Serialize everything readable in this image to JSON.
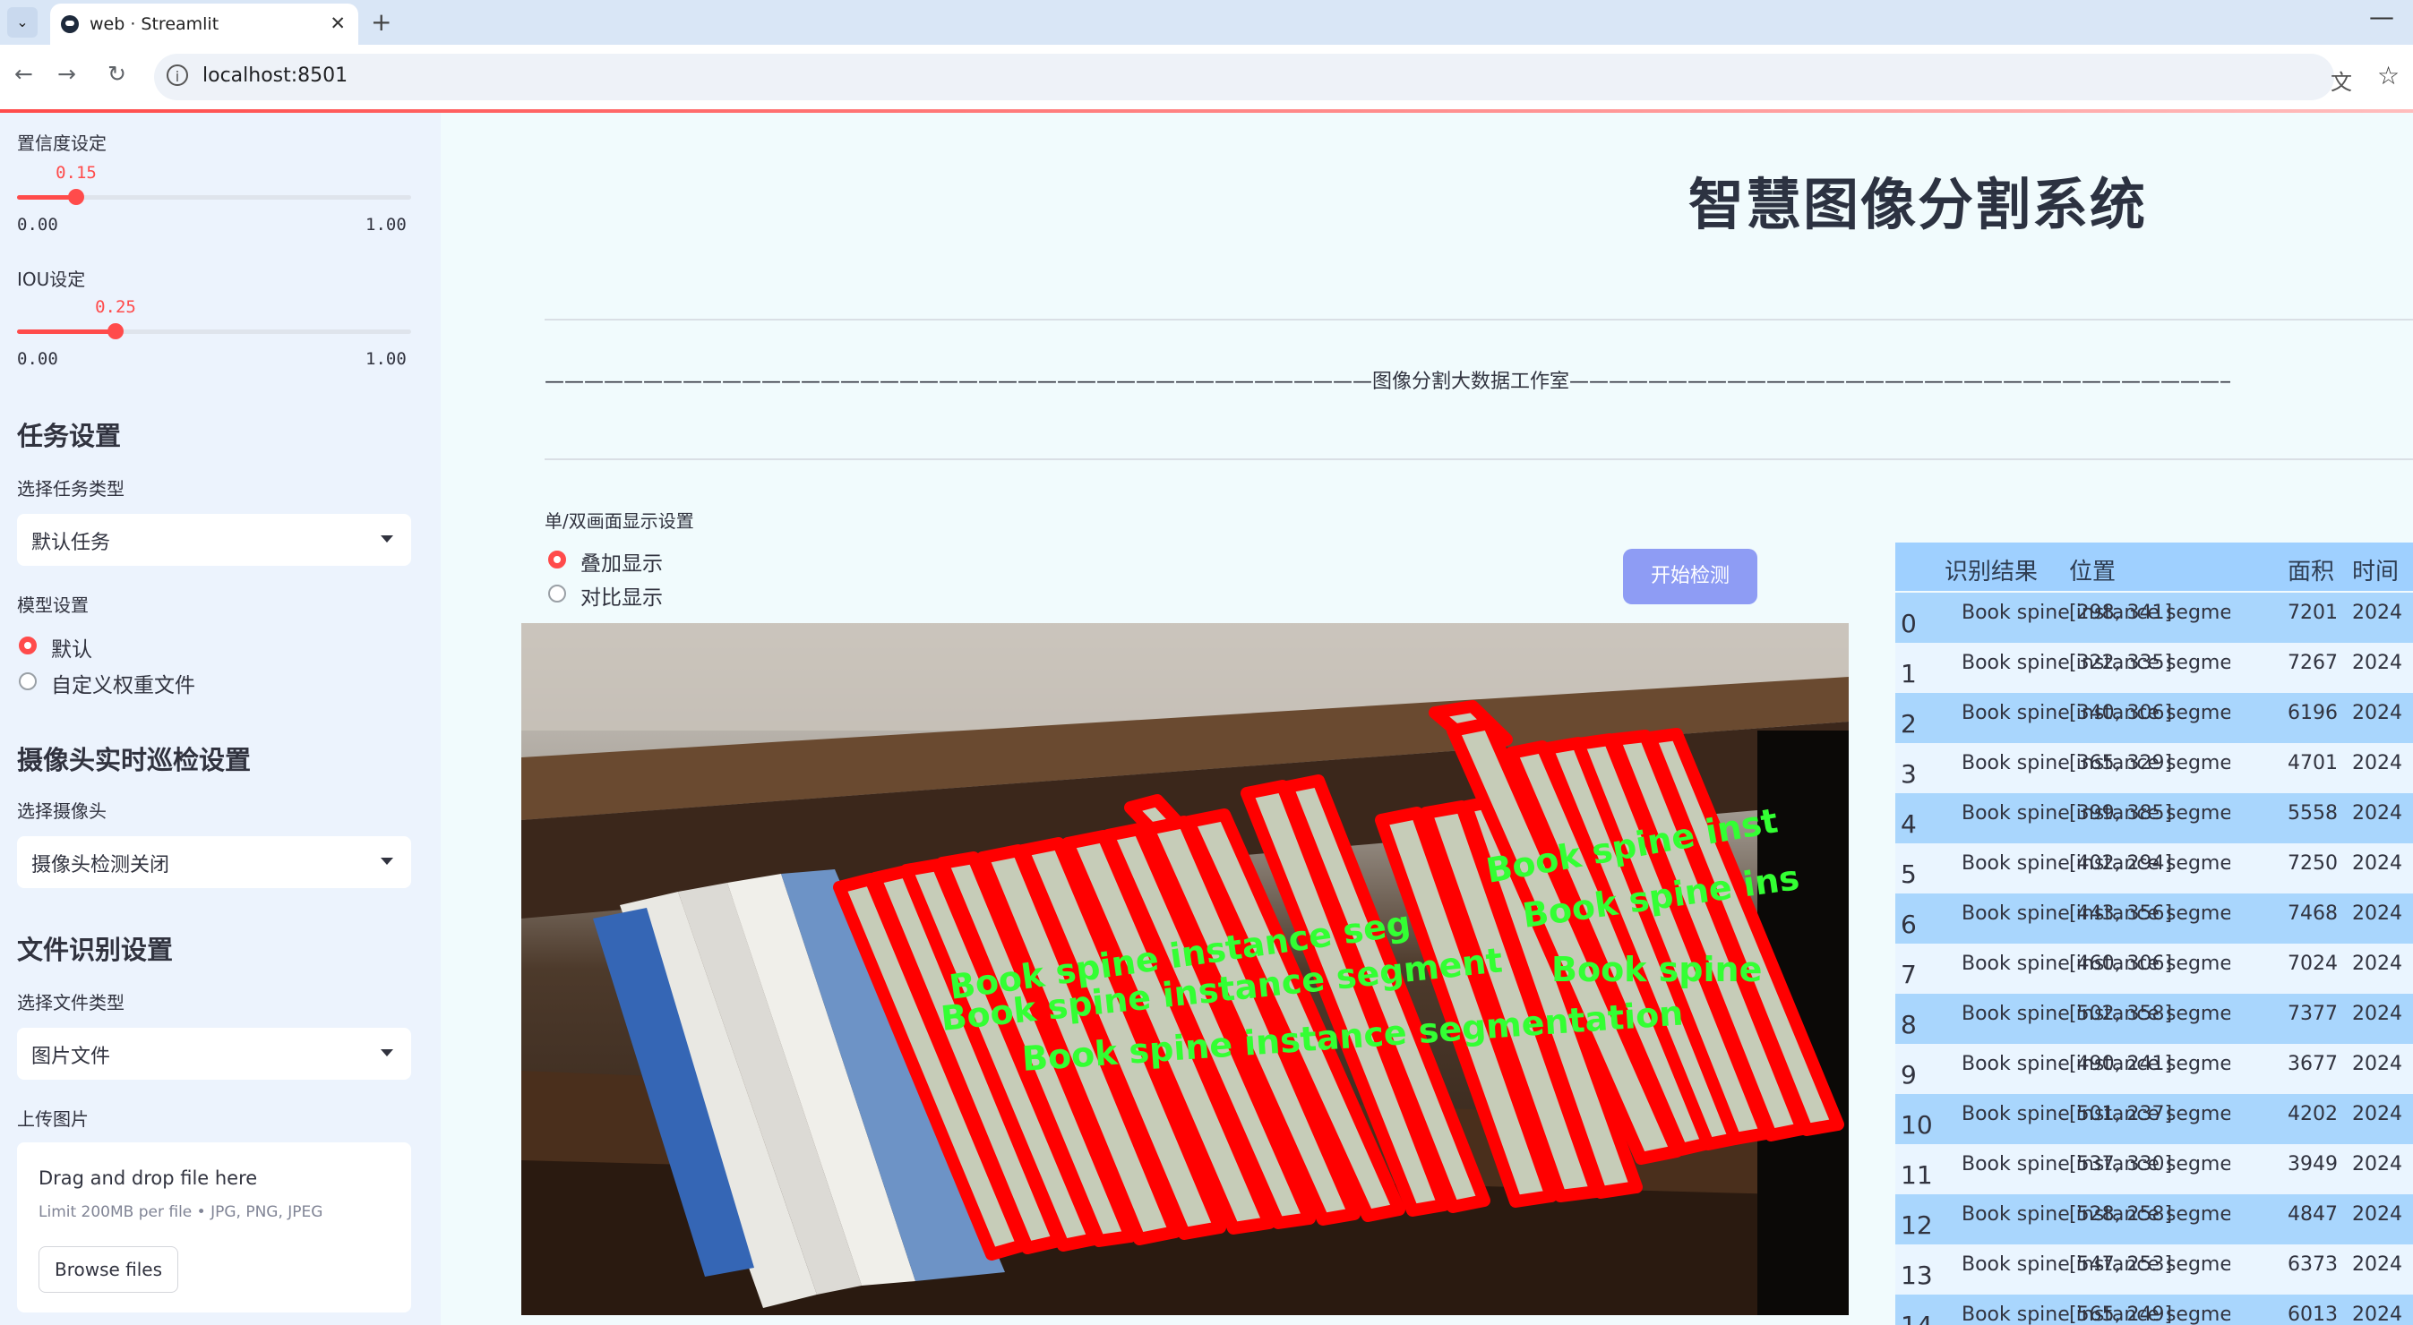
{
  "browser": {
    "tab_title": "web · Streamlit",
    "url": "localhost:8501",
    "new_tab_symbol": "+",
    "close_symbol": "✕"
  },
  "sidebar": {
    "confidence": {
      "label": "置信度设定",
      "value": "0.15",
      "value_fraction": 0.15,
      "min": "0.00",
      "max": "1.00"
    },
    "iou": {
      "label": "IOU设定",
      "value": "0.25",
      "value_fraction": 0.25,
      "min": "0.00",
      "max": "1.00"
    },
    "task_section": {
      "title": "任务设置",
      "select_label": "选择任务类型",
      "select_value": "默认任务"
    },
    "model_section": {
      "label": "模型设置",
      "options": [
        "默认",
        "自定义权重文件"
      ],
      "selected": 0
    },
    "camera_section": {
      "title": "摄像头实时巡检设置",
      "select_label": "选择摄像头",
      "select_value": "摄像头检测关闭"
    },
    "file_section": {
      "title": "文件识别设置",
      "select_label": "选择文件类型",
      "select_value": "图片文件",
      "upload_label": "上传图片"
    },
    "uploader": {
      "title": "Drag and drop file here",
      "limit": "Limit 200MB per file • JPG, PNG, JPEG",
      "button": "Browse files"
    }
  },
  "main": {
    "title": "智慧图像分割系统",
    "divider_text": "——————————————————————————————————————————图像分割大数据工作室————————————————————————————————————————",
    "display_label": "单/双画面显示设置",
    "display_options": [
      "叠加显示",
      "对比显示"
    ],
    "display_selected": 0,
    "start_button": "开始检测"
  },
  "table": {
    "headers": [
      "识别结果",
      "位置",
      "面积",
      "时间"
    ],
    "rows": [
      {
        "idx": "0",
        "result": "Book spine instance segmentation",
        "pos": "[298, 341]",
        "area": "7201",
        "time": "2024"
      },
      {
        "idx": "1",
        "result": "Book spine instance segmentation",
        "pos": "[322, 335]",
        "area": "7267",
        "time": "2024"
      },
      {
        "idx": "2",
        "result": "Book spine instance segmentation",
        "pos": "[340, 306]",
        "area": "6196",
        "time": "2024"
      },
      {
        "idx": "3",
        "result": "Book spine instance segmentation",
        "pos": "[365, 329]",
        "area": "4701",
        "time": "2024"
      },
      {
        "idx": "4",
        "result": "Book spine instance segmentation",
        "pos": "[399, 385]",
        "area": "5558",
        "time": "2024"
      },
      {
        "idx": "5",
        "result": "Book spine instance segmentation",
        "pos": "[402, 294]",
        "area": "7250",
        "time": "2024"
      },
      {
        "idx": "6",
        "result": "Book spine instance segmentation",
        "pos": "[443, 356]",
        "area": "7468",
        "time": "2024"
      },
      {
        "idx": "7",
        "result": "Book spine instance segmentation",
        "pos": "[460, 306]",
        "area": "7024",
        "time": "2024"
      },
      {
        "idx": "8",
        "result": "Book spine instance segmentation",
        "pos": "[502, 358]",
        "area": "7377",
        "time": "2024"
      },
      {
        "idx": "9",
        "result": "Book spine instance segmentation",
        "pos": "[490, 241]",
        "area": "3677",
        "time": "2024"
      },
      {
        "idx": "10",
        "result": "Book spine instance segmentation",
        "pos": "[501, 237]",
        "area": "4202",
        "time": "2024"
      },
      {
        "idx": "11",
        "result": "Book spine instance segmentation",
        "pos": "[537, 330]",
        "area": "3949",
        "time": "2024"
      },
      {
        "idx": "12",
        "result": "Book spine instance segmentation",
        "pos": "[528, 258]",
        "area": "4847",
        "time": "2024"
      },
      {
        "idx": "13",
        "result": "Book spine instance segmentation",
        "pos": "[547, 253]",
        "area": "6373",
        "time": "2024"
      },
      {
        "idx": "14",
        "result": "Book spine instance segmentation",
        "pos": "[565, 249]",
        "area": "6013",
        "time": "2024"
      }
    ]
  },
  "colors": {
    "accent": "#ff4b4b",
    "sidebar_bg": "#ecf3fd",
    "main_bg": "#f1fbfd",
    "button_bg": "#8e9cf4",
    "table_header": "#9fd0ff",
    "mask_outline": "#ff0000",
    "label_text": "#33ff33"
  },
  "icons": [
    "chevron-down-icon",
    "streamlit-icon",
    "close-icon",
    "plus-icon",
    "back-icon",
    "forward-icon",
    "reload-icon",
    "site-info-icon",
    "translate-icon",
    "star-icon",
    "minimize-icon"
  ]
}
